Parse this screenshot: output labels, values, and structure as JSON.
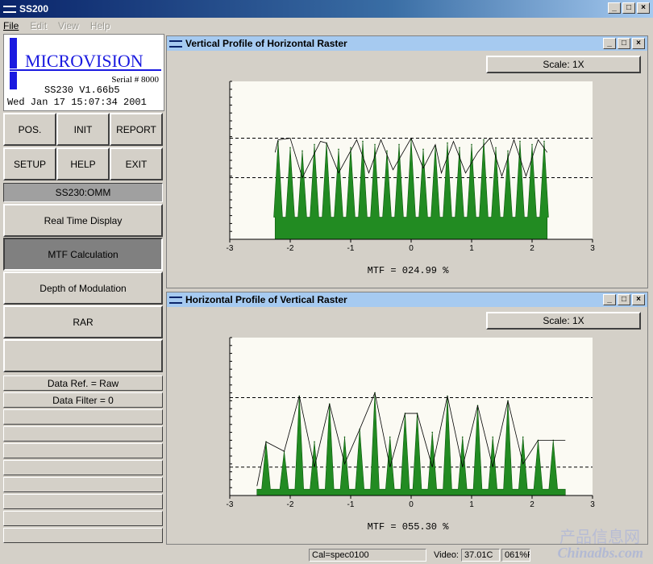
{
  "app": {
    "title": "SS200"
  },
  "menu": {
    "items": [
      {
        "label": "File",
        "enabled": true
      },
      {
        "label": "Edit",
        "enabled": false
      },
      {
        "label": "View",
        "enabled": false
      },
      {
        "label": "Help",
        "enabled": false
      }
    ]
  },
  "logo": {
    "text": "MICROVISION",
    "serial": "Serial # 8000",
    "version": "SS230 V1.66b5",
    "datetime": "Wed Jan 17 15:07:34 2001",
    "accent": "#1a1ae0"
  },
  "buttons": {
    "pos": "POS.",
    "init": "INIT",
    "report": "REPORT",
    "setup": "SETUP",
    "help": "HELP",
    "exit": "EXIT"
  },
  "mode_label": "SS230:OMM",
  "modes": [
    {
      "label": "Real Time Display",
      "active": false
    },
    {
      "label": "MTF Calculation",
      "active": true
    },
    {
      "label": "Depth of Modulation",
      "active": false
    },
    {
      "label": "RAR",
      "active": false
    },
    {
      "label": "",
      "active": false
    }
  ],
  "data_ref": "Data Ref. = Raw",
  "data_filter": "Data Filter = 0",
  "windows": {
    "top": {
      "title": "Vertical Profile of Horizontal Raster",
      "scale": "Scale: 1X",
      "mtf": "MTF = 024.99 %"
    },
    "bottom": {
      "title": "Horizontal Profile of Vertical Raster",
      "scale": "Scale: 1X",
      "mtf": "MTF = 055.30 %"
    }
  },
  "chart_data": [
    {
      "type": "area",
      "title": "Vertical Profile of Horizontal Raster",
      "xlim": [
        -3,
        3
      ],
      "ylim": [
        0,
        1
      ],
      "xticks": [
        "-3",
        "-2",
        "-1",
        "0",
        "1",
        "2",
        "3"
      ],
      "dashed_levels": [
        0.64,
        0.39
      ],
      "x_start": -2.25,
      "x_end": 2.25,
      "baseline": 0.14,
      "peaks_x": [
        -2.2,
        -2.0,
        -1.8,
        -1.6,
        -1.4,
        -1.2,
        -1.0,
        -0.8,
        -0.6,
        -0.4,
        -0.2,
        0.0,
        0.2,
        0.4,
        0.6,
        0.8,
        1.0,
        1.2,
        1.4,
        1.6,
        1.8,
        2.0,
        2.2
      ],
      "peaks_y": [
        0.62,
        0.58,
        0.56,
        0.6,
        0.61,
        0.57,
        0.58,
        0.62,
        0.6,
        0.56,
        0.6,
        0.63,
        0.57,
        0.59,
        0.61,
        0.58,
        0.6,
        0.63,
        0.58,
        0.56,
        0.62,
        0.6,
        0.62
      ],
      "envelope_x": [
        -2.25,
        -2.2,
        -2.0,
        -1.8,
        -1.5,
        -1.4,
        -1.2,
        -0.9,
        -0.7,
        -0.5,
        -0.3,
        0.0,
        0.2,
        0.4,
        0.5,
        0.7,
        0.9,
        1.1,
        1.3,
        1.5,
        1.7,
        1.9,
        2.1,
        2.25
      ],
      "envelope_y": [
        0.55,
        0.63,
        0.64,
        0.39,
        0.62,
        0.61,
        0.42,
        0.63,
        0.42,
        0.63,
        0.44,
        0.64,
        0.45,
        0.6,
        0.42,
        0.62,
        0.42,
        0.55,
        0.64,
        0.4,
        0.63,
        0.4,
        0.63,
        0.55
      ],
      "fill": "#228b22"
    },
    {
      "type": "area",
      "title": "Horizontal Profile of Vertical Raster",
      "xlim": [
        -3,
        3
      ],
      "ylim": [
        0,
        1
      ],
      "xticks": [
        "-3",
        "-2",
        "-1",
        "0",
        "1",
        "2",
        "3"
      ],
      "dashed_levels": [
        0.62,
        0.18
      ],
      "x_start": -2.55,
      "x_end": 2.55,
      "baseline": 0.04,
      "peaks_x": [
        -2.4,
        -2.1,
        -1.85,
        -1.6,
        -1.35,
        -1.1,
        -0.85,
        -0.6,
        -0.35,
        -0.1,
        0.1,
        0.35,
        0.6,
        0.85,
        1.1,
        1.35,
        1.6,
        1.85,
        2.1,
        2.35
      ],
      "peaks_y": [
        0.34,
        0.28,
        0.63,
        0.34,
        0.58,
        0.37,
        0.42,
        0.65,
        0.37,
        0.52,
        0.52,
        0.4,
        0.63,
        0.37,
        0.57,
        0.37,
        0.6,
        0.37,
        0.35,
        0.35
      ],
      "envelope_x": [
        -2.55,
        -2.4,
        -2.1,
        -1.85,
        -1.6,
        -1.35,
        -1.1,
        -0.85,
        -0.6,
        -0.35,
        -0.1,
        0.1,
        0.35,
        0.6,
        0.85,
        1.1,
        1.35,
        1.6,
        1.85,
        2.1,
        2.35,
        2.55
      ],
      "envelope_y": [
        0.06,
        0.34,
        0.28,
        0.63,
        0.18,
        0.58,
        0.2,
        0.42,
        0.65,
        0.18,
        0.52,
        0.52,
        0.18,
        0.63,
        0.18,
        0.57,
        0.18,
        0.6,
        0.2,
        0.35,
        0.35,
        0.35
      ],
      "fill": "#228b22"
    }
  ],
  "statusbar": {
    "cal": "Cal=spec0100",
    "video_label": "Video:",
    "temp": "37.01C",
    "extra": "061%F"
  },
  "watermark": {
    "cn": "产品信息网",
    "en": "Chinadbs.com"
  }
}
